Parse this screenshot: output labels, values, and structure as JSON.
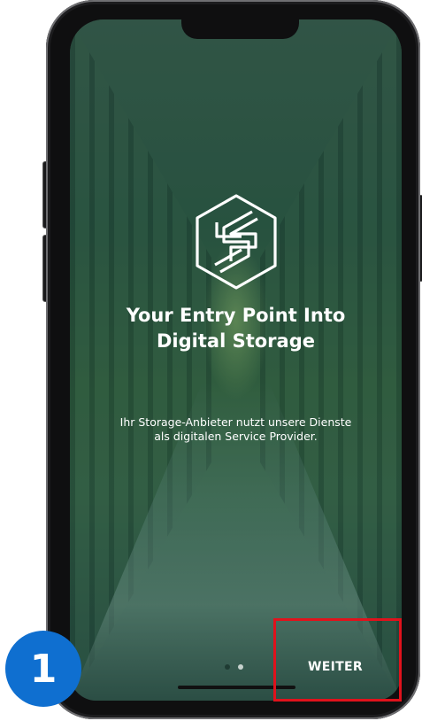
{
  "screen": {
    "logo_icon": "storage-s-hexagon-logo",
    "title_line1": "Your Entry Point Into",
    "title_line2": "Digital Storage",
    "subtitle": "Ihr Storage-Anbieter nutzt unsere Dienste als digitalen Service Provider.",
    "pagination": {
      "current": 1,
      "total": 2
    },
    "next_label": "WEITER"
  },
  "annotation": {
    "step_number": "1",
    "badge_color": "#0f6fd0",
    "highlight_color": "#e0121c"
  },
  "colors": {
    "accent_green": "#2f5a45",
    "dot_active": "#1f3b33",
    "dot_inactive": "#c7d2ce"
  }
}
